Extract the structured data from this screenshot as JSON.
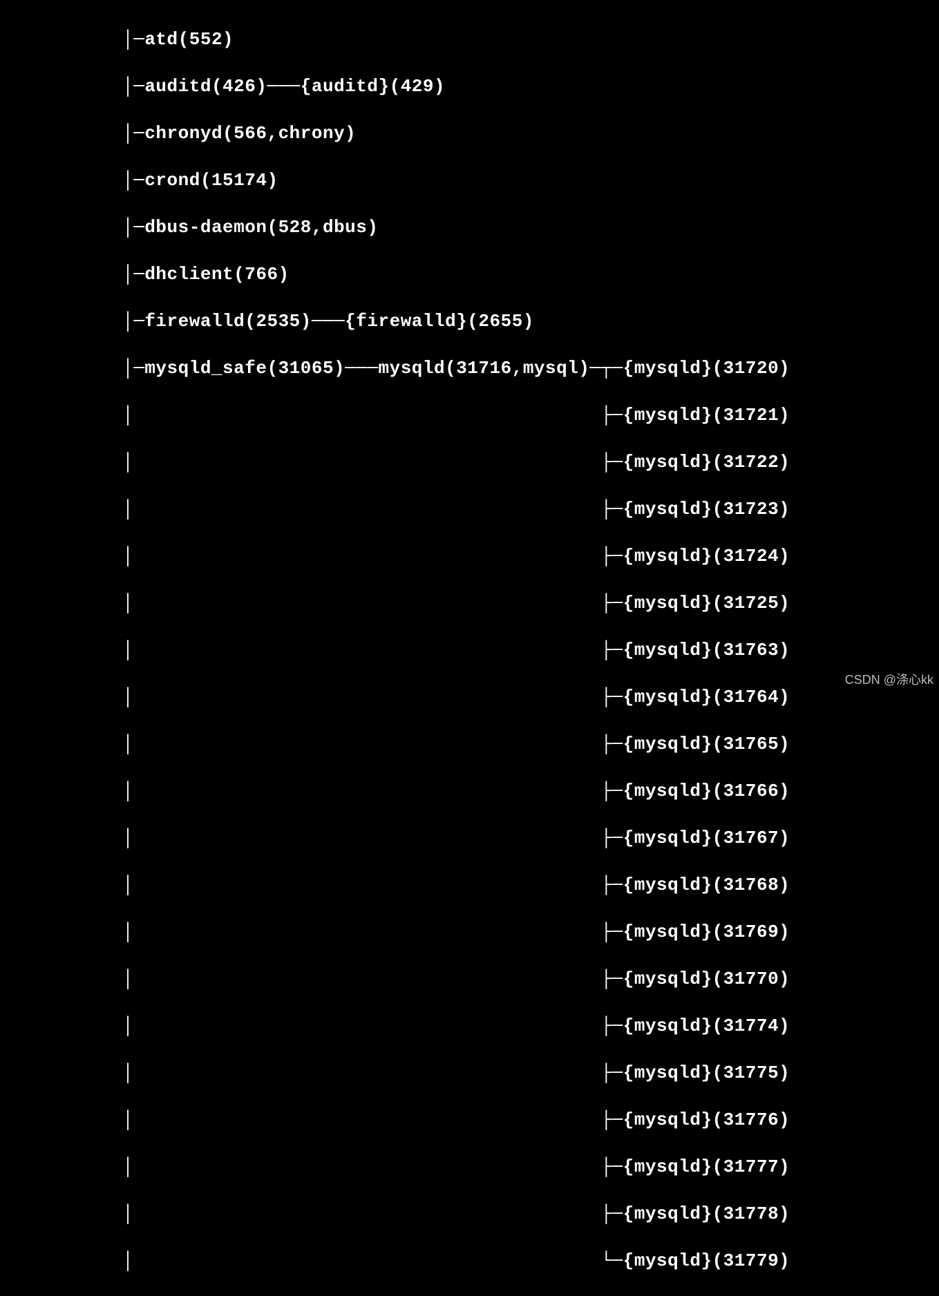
{
  "tree": {
    "prefix": "           │",
    "lines": [
      "─atd(552)",
      "─auditd(426)───{auditd}(429)",
      "─chronyd(566,chrony)",
      "─crond(15174)",
      "─dbus-daemon(528,dbus)",
      "─dhclient(766)",
      "─firewalld(2535)───{firewalld}(2655)",
      "─mysqld_safe(31065)───mysqld(31716,mysql)─┬─{mysqld}(31720)"
    ],
    "thread_prefix": "           │                                          ",
    "mysqld_threads": [
      "├─{mysqld}(31721)",
      "├─{mysqld}(31722)",
      "├─{mysqld}(31723)",
      "├─{mysqld}(31724)",
      "├─{mysqld}(31725)",
      "├─{mysqld}(31763)",
      "├─{mysqld}(31764)",
      "├─{mysqld}(31765)",
      "├─{mysqld}(31766)",
      "├─{mysqld}(31767)",
      "├─{mysqld}(31768)",
      "├─{mysqld}(31769)",
      "├─{mysqld}(31770)",
      "├─{mysqld}(31774)",
      "├─{mysqld}(31775)",
      "├─{mysqld}(31776)",
      "├─{mysqld}(31777)",
      "├─{mysqld}(31778)",
      "└─{mysqld}(31779)"
    ]
  },
  "watermark": "CSDN @涤心kk"
}
